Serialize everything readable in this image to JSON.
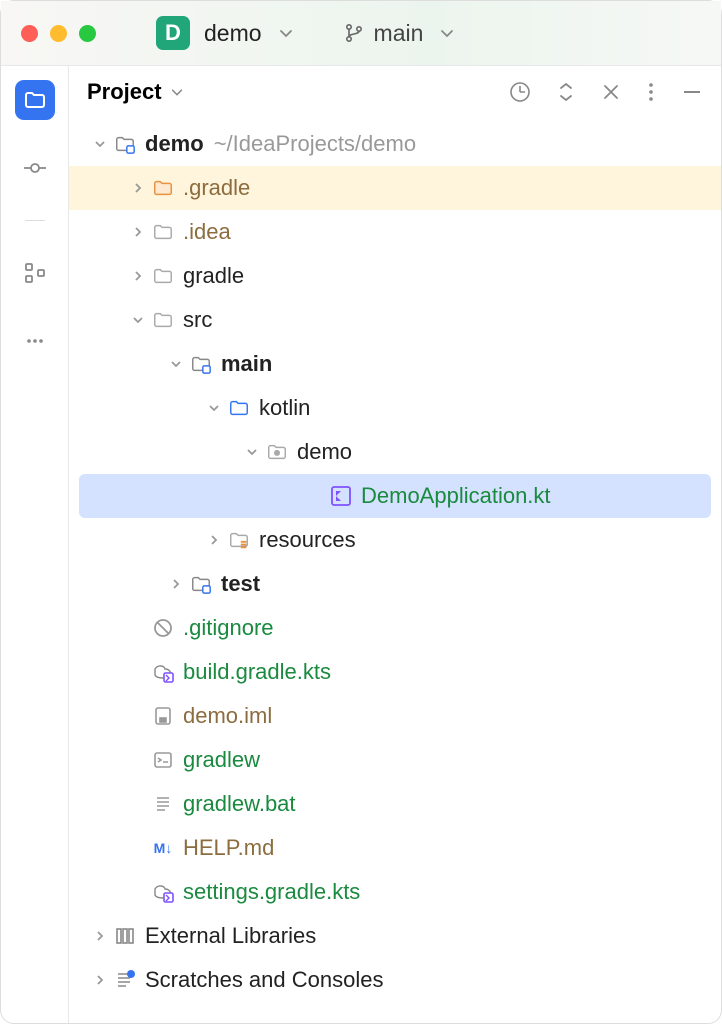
{
  "titlebar": {
    "project_initial": "D",
    "project_name": "demo",
    "branch": "main"
  },
  "panel": {
    "title": "Project"
  },
  "tree": {
    "root": {
      "name": "demo",
      "path": "~/IdeaProjects/demo"
    },
    "items": [
      {
        "name": ".gradle"
      },
      {
        "name": ".idea"
      },
      {
        "name": "gradle"
      },
      {
        "name": "src"
      },
      {
        "name": "main"
      },
      {
        "name": "kotlin"
      },
      {
        "name": "demo"
      },
      {
        "name": "DemoApplication.kt"
      },
      {
        "name": "resources"
      },
      {
        "name": "test"
      },
      {
        "name": ".gitignore"
      },
      {
        "name": "build.gradle.kts"
      },
      {
        "name": "demo.iml"
      },
      {
        "name": "gradlew"
      },
      {
        "name": "gradlew.bat"
      },
      {
        "name": "HELP.md"
      },
      {
        "name": "settings.gradle.kts"
      },
      {
        "name": "External Libraries"
      },
      {
        "name": "Scratches and Consoles"
      }
    ]
  }
}
